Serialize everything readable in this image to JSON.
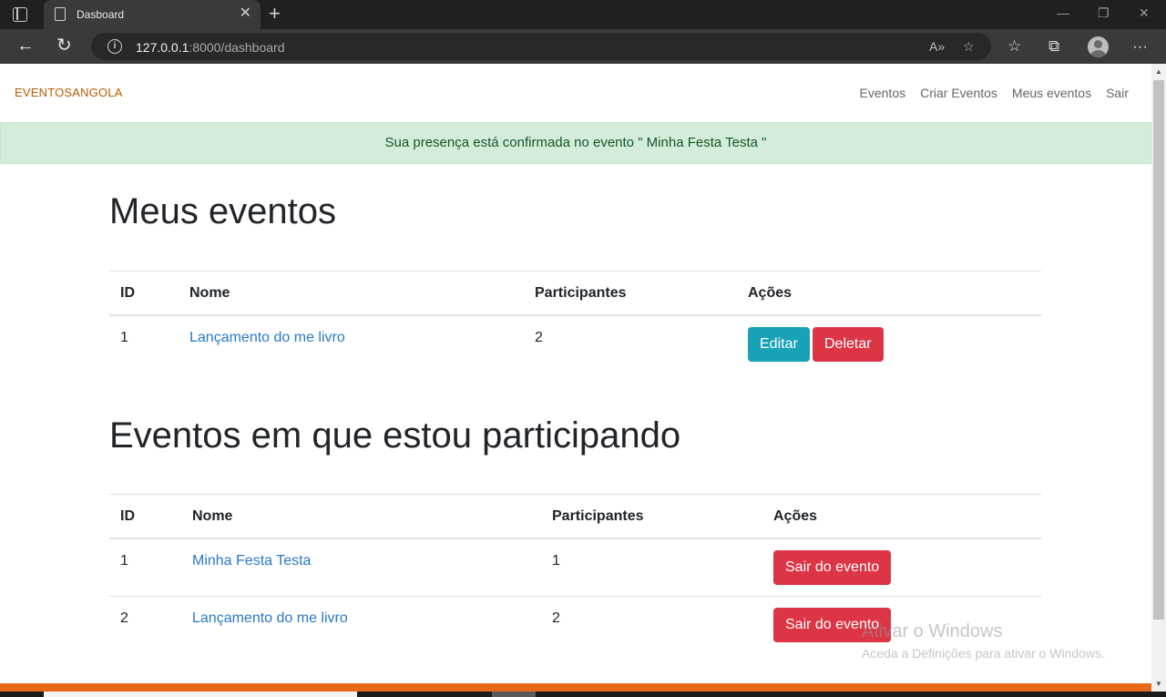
{
  "browser": {
    "tab_title": "Dasboard",
    "url_host": "127.0.0.1",
    "url_rest": ":8000/dashboard"
  },
  "navbar": {
    "brand": "EVENTOSANGOLA",
    "links": [
      "Eventos",
      "Criar Eventos",
      "Meus eventos",
      "Sair"
    ]
  },
  "alert": {
    "message": "Sua presença está confirmada no evento \" Minha Festa Testa \""
  },
  "my_events": {
    "title": "Meus eventos",
    "columns": [
      "ID",
      "Nome",
      "Participantes",
      "Ações"
    ],
    "rows": [
      {
        "id": "1",
        "name": "Lançamento do me livro",
        "participants": "2",
        "edit_label": "Editar",
        "delete_label": "Deletar"
      }
    ]
  },
  "participating": {
    "title": "Eventos em que estou participando",
    "columns": [
      "ID",
      "Nome",
      "Participantes",
      "Ações"
    ],
    "rows": [
      {
        "id": "1",
        "name": "Minha Festa Testa",
        "participants": "1",
        "leave_label": "Sair do evento"
      },
      {
        "id": "2",
        "name": "Lançamento do me livro",
        "participants": "2",
        "leave_label": "Sair do evento"
      }
    ]
  },
  "watermark": {
    "line1": "Ativar o Windows",
    "line2": "Aceda a Definições para ativar o Windows."
  },
  "colors": {
    "brand": "#b85c00",
    "alert_bg": "#d4edda",
    "info": "#17a2b8",
    "danger": "#dc3545",
    "link": "#2a78c8",
    "footer": "#e8681a"
  }
}
